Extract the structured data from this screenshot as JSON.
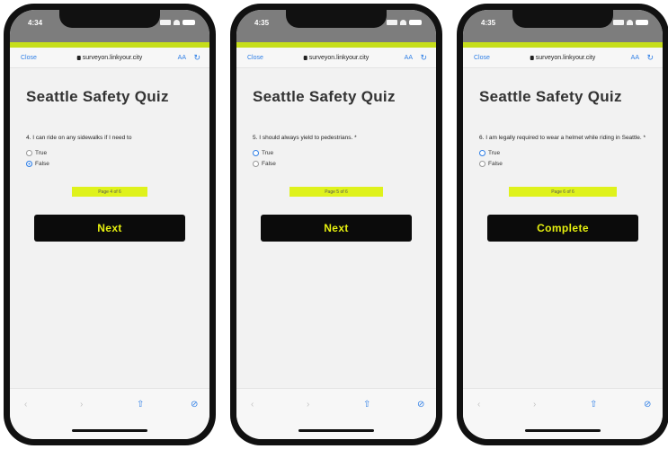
{
  "phones": [
    {
      "time": "4:34",
      "close": "Close",
      "domain": "surveyon.linkyour.city",
      "aa": "AA",
      "title": "Seattle Safety Quiz",
      "question": "4. I can ride on any sidewalks if I need to",
      "options": [
        "True",
        "False"
      ],
      "selected": 1,
      "page": "Page 4 of 6",
      "button": "Next"
    },
    {
      "time": "4:35",
      "close": "Close",
      "domain": "surveyon.linkyour.city",
      "aa": "AA",
      "title": "Seattle Safety Quiz",
      "question": "5. I should always yield to pedestrians. *",
      "options": [
        "True",
        "False"
      ],
      "selected": -1,
      "page": "Page 5 of 6",
      "button": "Next"
    },
    {
      "time": "4:35",
      "close": "Close",
      "domain": "surveyon.linkyour.city",
      "aa": "AA",
      "title": "Seattle Safety Quiz",
      "question": "6. I am legally required to wear a helmet while riding in Seattle. *",
      "options": [
        "True",
        "False"
      ],
      "selected": -1,
      "page": "Page 6 of 6",
      "button": "Complete"
    }
  ],
  "colors": {
    "accent": "#c6de1a",
    "button_bg": "#0b0b0b",
    "button_text": "#e6f00f",
    "link": "#2f7fe6"
  },
  "toolbar_icons": [
    "back-icon",
    "forward-icon",
    "share-icon",
    "compass-icon"
  ]
}
